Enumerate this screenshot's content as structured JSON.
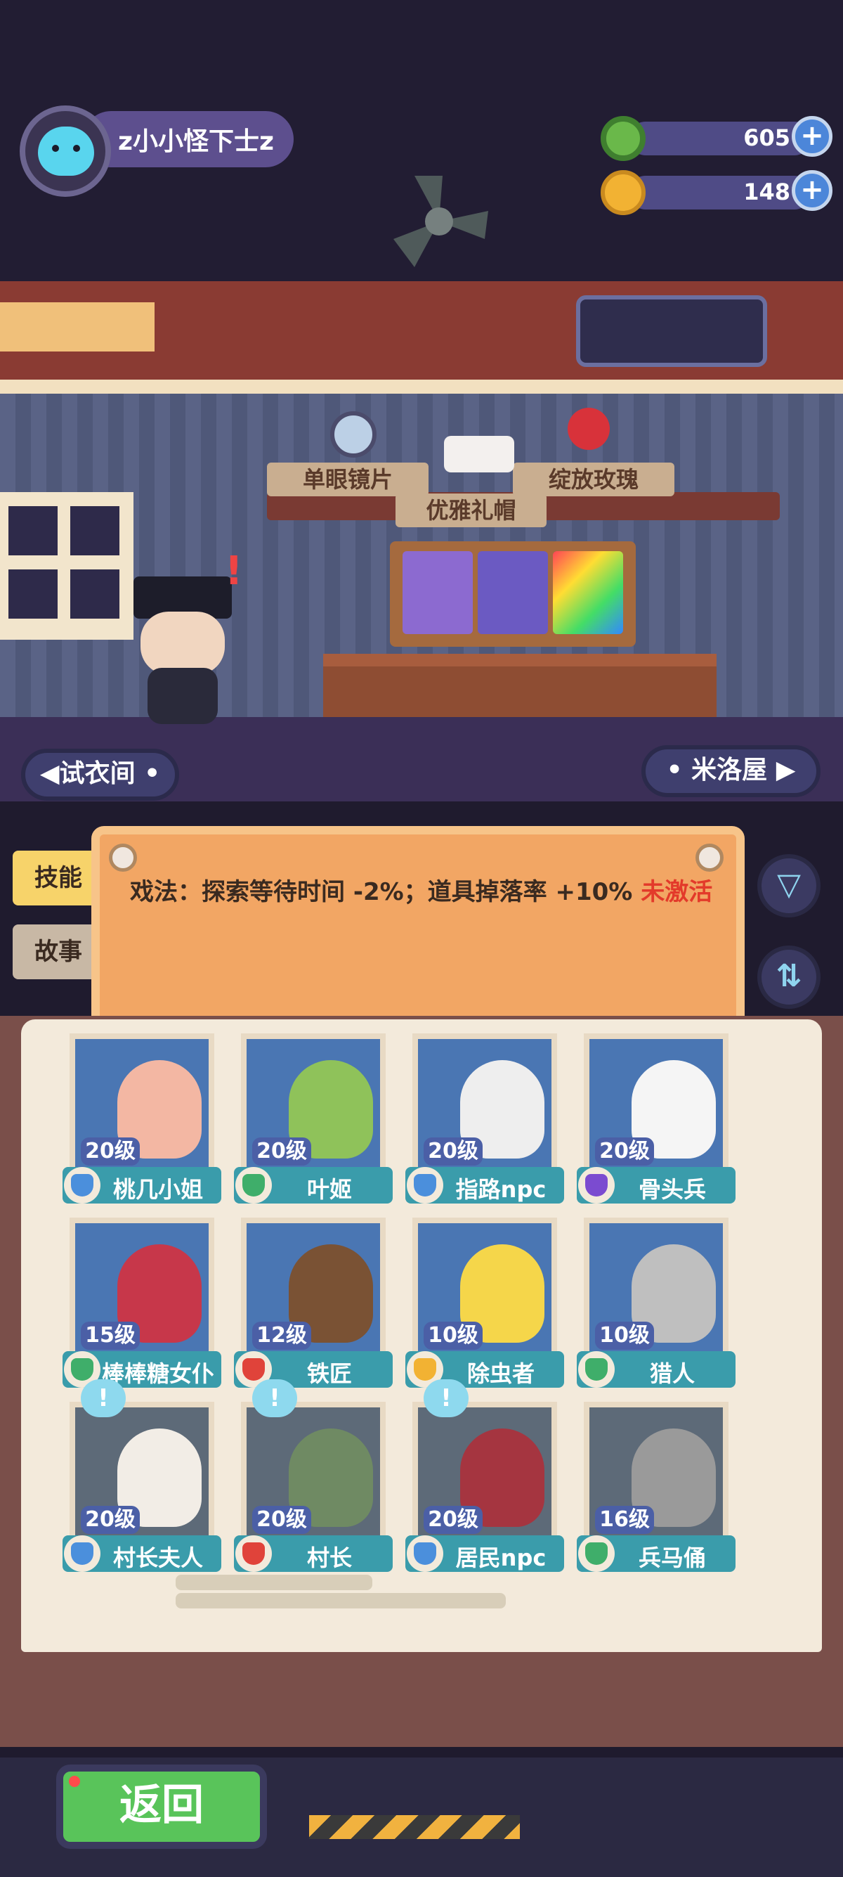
{
  "player": {
    "name": "z小小怪下士z"
  },
  "resources": [
    {
      "icon": "green-donut-coin-icon",
      "value": "605",
      "color": "#6ab84a"
    },
    {
      "icon": "yellow-planet-coin-icon",
      "value": "148",
      "color": "#f2b233"
    }
  ],
  "shelf_items": [
    {
      "label": "单眼镜片"
    },
    {
      "label": "优雅礼帽"
    },
    {
      "label": "绽放玫瑰"
    }
  ],
  "nav": {
    "left_label": "试衣间",
    "right_label": "米洛屋"
  },
  "skill": {
    "tabs": [
      "技能",
      "故事"
    ],
    "text_main": "戏法：探索等待时间 -2%；道具掉落率 +10%",
    "text_status": "未激活"
  },
  "characters": [
    {
      "level": "20级",
      "name": "桃几小姐",
      "shield_color": "#4b8fdc",
      "face_color": "#f3b7a3",
      "frame": "blue"
    },
    {
      "level": "20级",
      "name": "叶姬",
      "shield_color": "#3fae6a",
      "face_color": "#8fc25a",
      "frame": "blue"
    },
    {
      "level": "20级",
      "name": "指路npc",
      "shield_color": "#4b8fdc",
      "face_color": "#eeeeee",
      "frame": "blue"
    },
    {
      "level": "20级",
      "name": "骨头兵",
      "shield_color": "#7b4bd0",
      "face_color": "#f5f5f5",
      "frame": "blue"
    },
    {
      "level": "15级",
      "name": "棒棒糖女仆",
      "shield_color": "#3fae6a",
      "face_color": "#c7374a",
      "frame": "blue"
    },
    {
      "level": "12级",
      "name": "铁匠",
      "shield_color": "#e0433a",
      "face_color": "#7a5234",
      "frame": "blue"
    },
    {
      "level": "10级",
      "name": "除虫者",
      "shield_color": "#f2b233",
      "face_color": "#f5d64a",
      "frame": "blue"
    },
    {
      "level": "10级",
      "name": "猎人",
      "shield_color": "#3fae6a",
      "face_color": "#bfbfbf",
      "frame": "blue"
    },
    {
      "level": "20级",
      "name": "村长夫人",
      "shield_color": "#4b8fdc",
      "face_color": "#f2ede6",
      "frame": "grey",
      "notice": "!"
    },
    {
      "level": "20级",
      "name": "村长",
      "shield_color": "#e0433a",
      "face_color": "#6f8a63",
      "frame": "grey",
      "notice": "!"
    },
    {
      "level": "20级",
      "name": "居民npc",
      "shield_color": "#4b8fdc",
      "face_color": "#a53540",
      "frame": "grey",
      "notice": "!"
    },
    {
      "level": "16级",
      "name": "兵马俑",
      "shield_color": "#3fae6a",
      "face_color": "#9a9a9a",
      "frame": "grey"
    }
  ],
  "back_button": {
    "label": "返回"
  }
}
